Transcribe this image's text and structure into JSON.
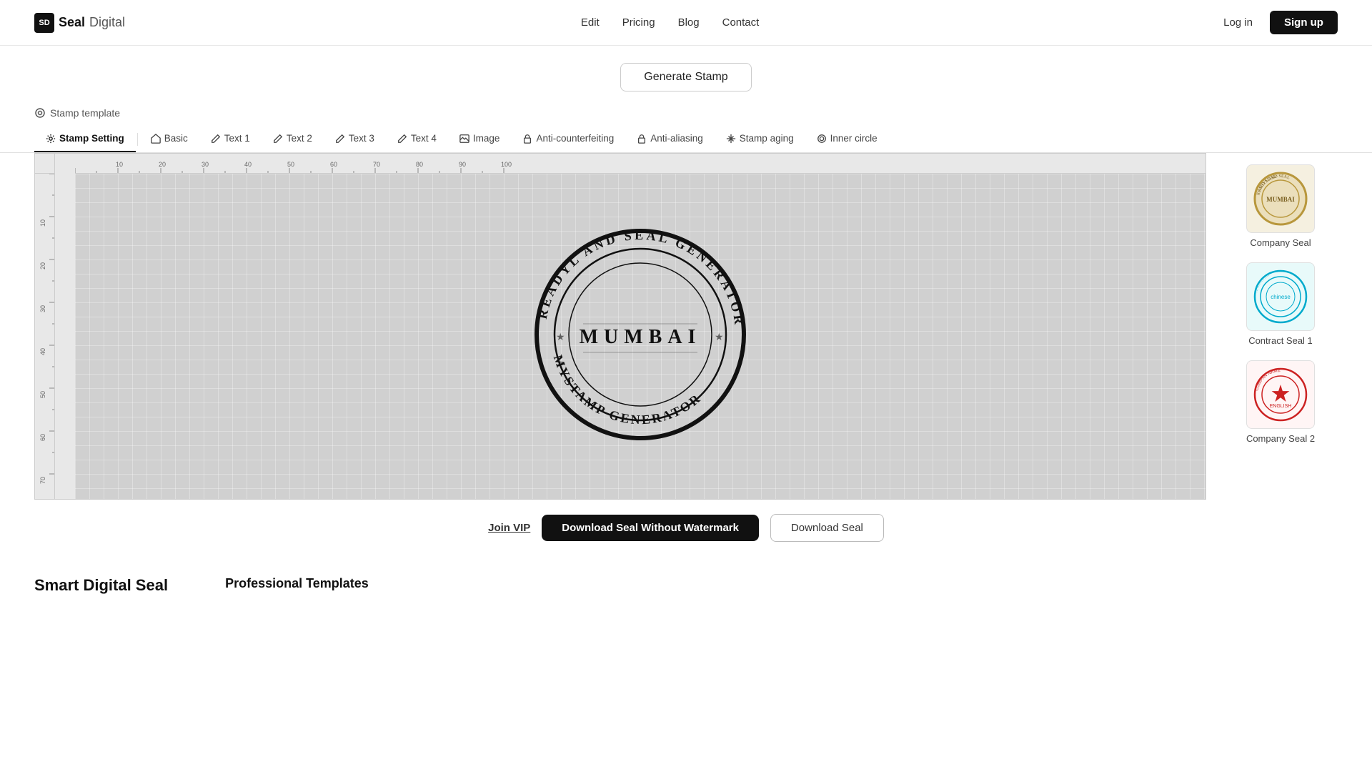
{
  "header": {
    "logo_icon": "SD",
    "logo_seal": "Seal",
    "logo_digital": "Digital",
    "nav": [
      {
        "label": "Edit",
        "href": "#"
      },
      {
        "label": "Pricing",
        "href": "#"
      },
      {
        "label": "Blog",
        "href": "#"
      },
      {
        "label": "Contact",
        "href": "#"
      }
    ],
    "login_label": "Log in",
    "signup_label": "Sign up"
  },
  "generate": {
    "button_label": "Generate Stamp"
  },
  "stamp_template": {
    "label": "Stamp template"
  },
  "tabs": [
    {
      "id": "stamp-setting",
      "label": "Stamp Setting",
      "icon": "settings"
    },
    {
      "id": "basic",
      "label": "Basic",
      "icon": "home"
    },
    {
      "id": "text1",
      "label": "Text 1",
      "icon": "edit"
    },
    {
      "id": "text2",
      "label": "Text 2",
      "icon": "edit"
    },
    {
      "id": "text3",
      "label": "Text 3",
      "icon": "edit"
    },
    {
      "id": "text4",
      "label": "Text 4",
      "icon": "edit"
    },
    {
      "id": "image",
      "label": "Image",
      "icon": "image"
    },
    {
      "id": "anti-counterfeiting",
      "label": "Anti-counterfeiting",
      "icon": "lock"
    },
    {
      "id": "anti-aliasing",
      "label": "Anti-aliasing",
      "icon": "lock"
    },
    {
      "id": "stamp-aging",
      "label": "Stamp aging",
      "icon": "sparkle"
    },
    {
      "id": "inner-circle",
      "label": "Inner circle",
      "icon": "circle"
    }
  ],
  "stamp": {
    "outer_text_top": "READYL AND SEAL GENERATOR",
    "outer_text_bottom": "MYSTAMP GENERATOR",
    "center_text": "MUMBAI",
    "color": "#111111"
  },
  "templates": [
    {
      "id": "company-seal",
      "label": "Company Seal",
      "bg": "#d4b96a",
      "type": "gold"
    },
    {
      "id": "contract-seal-1",
      "label": "Contract Seal 1",
      "bg": "#e0f8f8",
      "type": "cyan"
    },
    {
      "id": "company-seal-2",
      "label": "Company Seal 2",
      "bg": "#fff0f0",
      "type": "red"
    }
  ],
  "sidebar_label": {
    "mumbai_seal": "MUmbAI Company Seal"
  },
  "download": {
    "join_vip_label": "Join VIP",
    "download_nowatermark_label": "Download Seal Without Watermark",
    "download_seal_label": "Download Seal"
  },
  "bottom": {
    "left_title": "Smart Digital Seal",
    "right_title": "Professional Templates"
  }
}
